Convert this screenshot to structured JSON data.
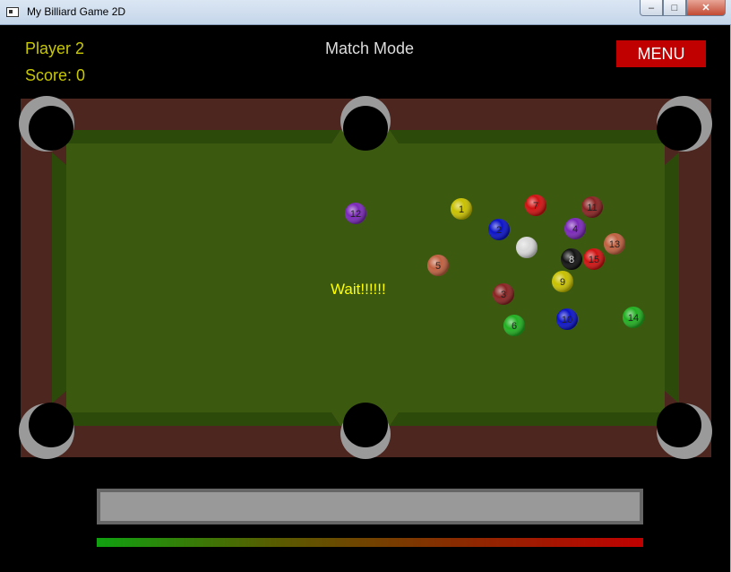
{
  "window": {
    "title": "My Billiard Game 2D",
    "controls": {
      "minimize": "–",
      "maximize": "□",
      "close": "✕"
    }
  },
  "hud": {
    "player": "Player 2",
    "score": "Score: 0",
    "mode": "Match Mode",
    "menu_label": "MENU",
    "message": "Wait!!!!!!"
  },
  "colors": {
    "felt": "#3b5a10",
    "cushion": "#2c4a0a",
    "rail": "#4d2620",
    "pocket": "#000000",
    "pocket_ring": "#9a9a9a",
    "hud_text": "#c8c800",
    "menu_bg": "#c00000"
  },
  "balls": [
    {
      "number": "1",
      "color": "#c8c000"
    },
    {
      "number": "2",
      "color": "#0a12c8"
    },
    {
      "number": "3",
      "color": "#8a2222"
    },
    {
      "number": "4",
      "color": "#7a28b8"
    },
    {
      "number": "5",
      "color": "#c06040"
    },
    {
      "number": "6",
      "color": "#20b020"
    },
    {
      "number": "7",
      "color": "#d01010"
    },
    {
      "number": "8",
      "color": "#111111"
    },
    {
      "number": "9",
      "color": "#c8c000"
    },
    {
      "number": "10",
      "color": "#0a12c8"
    },
    {
      "number": "11",
      "color": "#8a2222"
    },
    {
      "number": "12",
      "color": "#7a28b8"
    },
    {
      "number": "13",
      "color": "#c06040"
    },
    {
      "number": "14",
      "color": "#20b020"
    },
    {
      "number": "15",
      "color": "#d01010"
    },
    {
      "number": "",
      "color": "#d8d8d8"
    }
  ],
  "power": {
    "level": 0
  }
}
